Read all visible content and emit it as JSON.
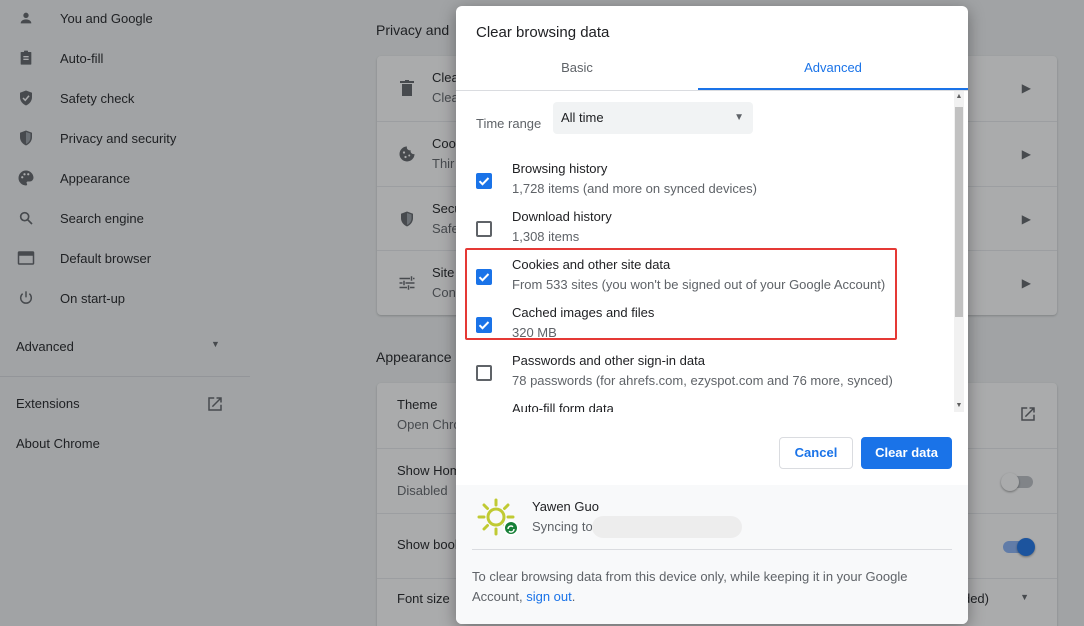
{
  "sidebar": {
    "items": [
      {
        "label": "You and Google",
        "icon": "person-icon"
      },
      {
        "label": "Auto-fill",
        "icon": "clipboard-icon"
      },
      {
        "label": "Safety check",
        "icon": "shield-check-icon"
      },
      {
        "label": "Privacy and security",
        "icon": "shield-icon"
      },
      {
        "label": "Appearance",
        "icon": "palette-icon"
      },
      {
        "label": "Search engine",
        "icon": "search-icon"
      },
      {
        "label": "Default browser",
        "icon": "browser-icon"
      },
      {
        "label": "On start-up",
        "icon": "power-icon"
      }
    ],
    "advanced_label": "Advanced",
    "extensions_label": "Extensions",
    "about_label": "About Chrome"
  },
  "background": {
    "privacy_section_title": "Privacy and",
    "privacy_rows": [
      {
        "t1": "Clea",
        "t2": "Clea"
      },
      {
        "t1": "Coo",
        "t2": "Thir"
      },
      {
        "t1": "Secu",
        "t2": "Safe"
      },
      {
        "t1": "Site",
        "t2": "Con"
      }
    ],
    "appearance_section_title": "Appearance",
    "appearance_rows": [
      {
        "t1": "Theme",
        "t2": "Open Chro"
      },
      {
        "t1": "Show Hom",
        "t2": "Disabled"
      },
      {
        "t1": "Show book"
      },
      {
        "t1": "Font size",
        "value": "ded)"
      }
    ]
  },
  "dialog": {
    "title": "Clear browsing data",
    "tabs": [
      {
        "label": "Basic",
        "selected": false
      },
      {
        "label": "Advanced",
        "selected": true
      }
    ],
    "time_range_label": "Time range",
    "time_range_value": "All time",
    "options": [
      {
        "title": "Browsing history",
        "subtitle": "1,728 items (and more on synced devices)",
        "checked": true
      },
      {
        "title": "Download history",
        "subtitle": "1,308 items",
        "checked": false
      },
      {
        "title": "Cookies and other site data",
        "subtitle": "From 533 sites (you won't be signed out of your Google Account)",
        "checked": true
      },
      {
        "title": "Cached images and files",
        "subtitle": "320 MB",
        "checked": true
      },
      {
        "title": "Passwords and other sign-in data",
        "subtitle": "78 passwords (for ahrefs.com, ezyspot.com and 76 more, synced)",
        "checked": false
      },
      {
        "title": "Auto-fill form data",
        "subtitle": "",
        "checked": false
      }
    ],
    "cancel_label": "Cancel",
    "clear_label": "Clear data",
    "account": {
      "name": "Yawen Guo",
      "sync_text": "Syncing to"
    },
    "footer_text": "To clear browsing data from this device only, while keeping it in your Google Account, ",
    "footer_link": "sign out",
    "footer_end": "."
  },
  "colors": {
    "accent": "#1a73e8",
    "highlight": "#e53935",
    "sync_badge": "#188038"
  }
}
